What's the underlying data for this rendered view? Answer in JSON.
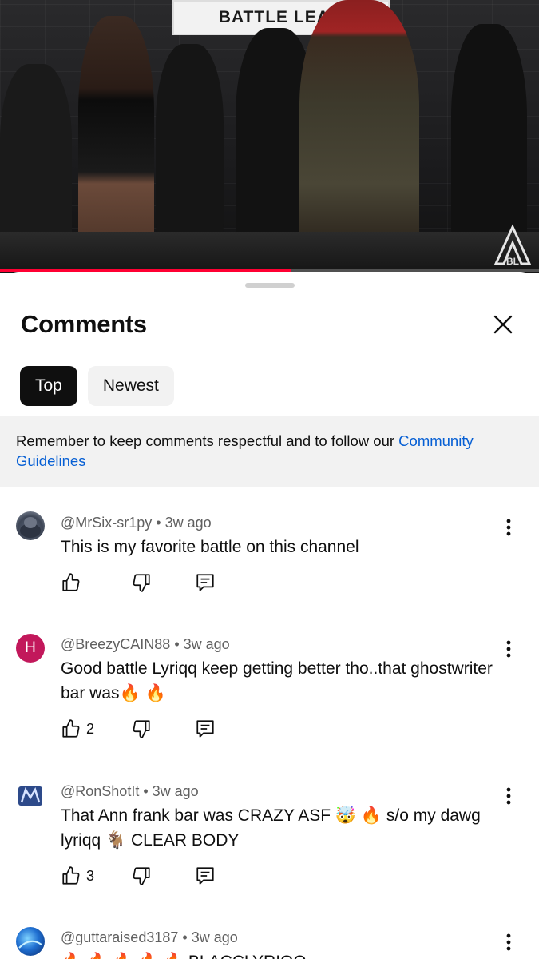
{
  "video": {
    "banner_text": "BATTLE LEAG",
    "watermark": "BL",
    "progress_percent": 54,
    "progress_color": "#ff0033"
  },
  "comments_panel": {
    "title": "Comments",
    "close_icon": "close-icon",
    "tabs": [
      {
        "label": "Top",
        "active": true
      },
      {
        "label": "Newest",
        "active": false
      }
    ],
    "notice": {
      "text": "Remember to keep comments respectful and to follow our ",
      "link": "Community Guidelines"
    },
    "comments": [
      {
        "author": "@MrSix-sr1py",
        "time": "3w ago",
        "text": "This is my favorite battle on this channel",
        "likes": "",
        "avatar": "photo"
      },
      {
        "author": "@BreezyCAIN88",
        "time": "3w ago",
        "text": "Good battle Lyriqq keep getting better tho..that ghostwriter bar was🔥 🔥",
        "likes": "2",
        "avatar": "letter",
        "avatar_letter": "H",
        "avatar_color": "#c2185b"
      },
      {
        "author": "@RonShotIt",
        "time": "3w ago",
        "text": "That Ann frank bar was CRAZY ASF 🤯 🔥  s/o my dawg lyriqq 🐐  CLEAR BODY",
        "likes": "3",
        "avatar": "logo"
      },
      {
        "author": "@guttaraised3187",
        "time": "3w ago",
        "text": "🔥 🔥 🔥 🔥 🔥 BLACCLYRIQQ",
        "likes": "",
        "avatar": "photo-blue"
      }
    ]
  }
}
